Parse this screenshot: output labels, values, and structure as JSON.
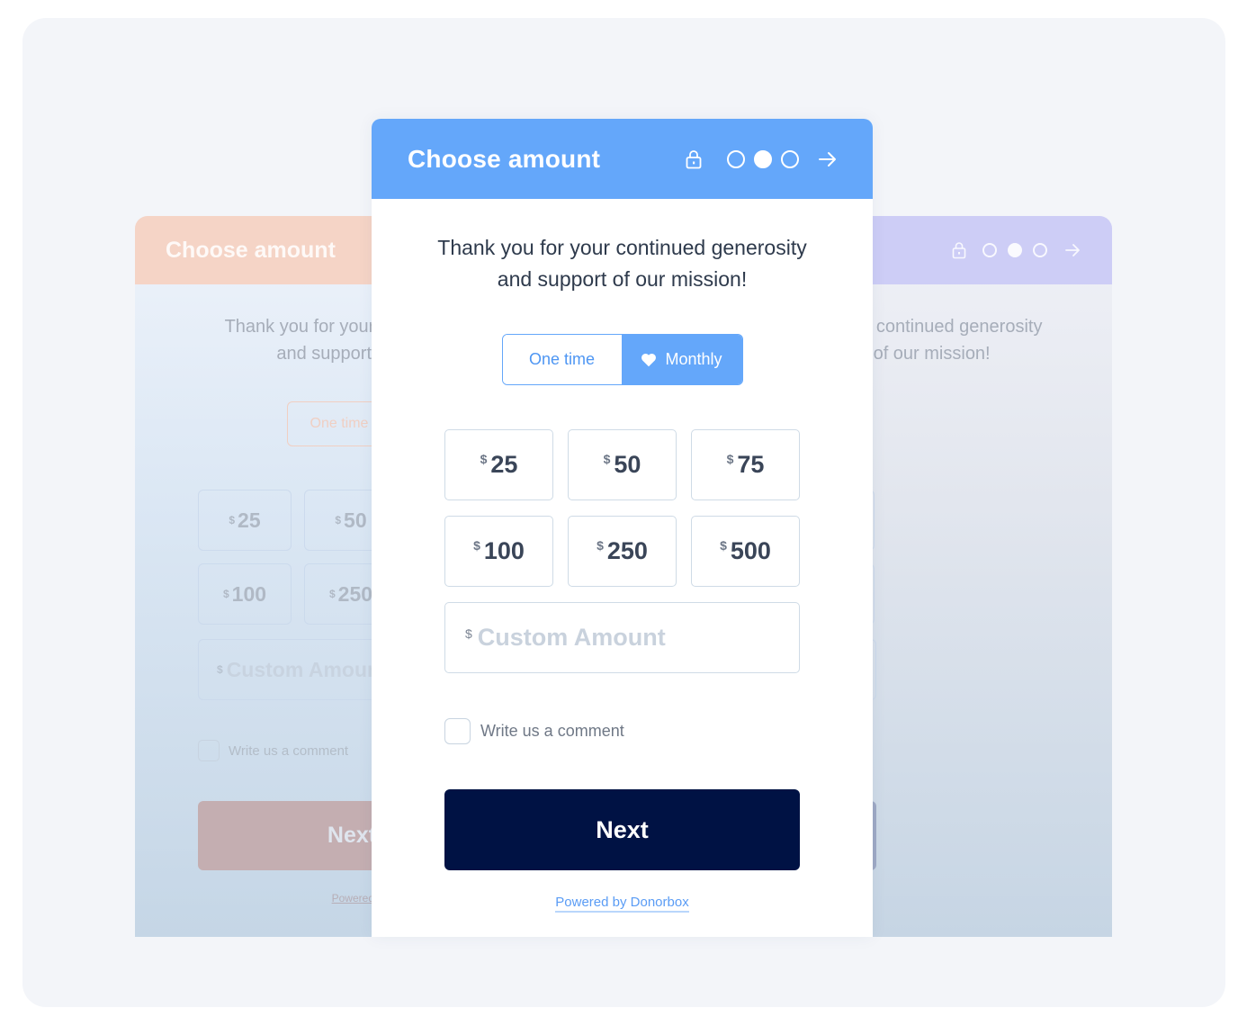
{
  "form": {
    "title": "Choose amount",
    "steps": {
      "total": 3,
      "current": 2
    },
    "message_line1": "Thank you for your continued generosity",
    "message_line2": "and support of our mission!",
    "frequency": {
      "options": [
        "One time",
        "Monthly"
      ],
      "selected": "Monthly"
    },
    "currency_symbol": "$",
    "amounts": [
      "25",
      "50",
      "75",
      "100",
      "250",
      "500"
    ],
    "custom_amount": {
      "value": "",
      "placeholder": "Custom Amount"
    },
    "comment": {
      "label": "Write us a comment",
      "checked": false
    },
    "next_label": "Next",
    "powered_by": "Powered by Donorbox"
  },
  "background_variants": [
    {
      "name": "peach",
      "accent": "#f5d4c6"
    },
    {
      "name": "lavender",
      "accent": "#cdcdf6"
    }
  ],
  "colors": {
    "header": "#64a7fa",
    "next_button": "#001244",
    "link": "#5a9cf5"
  }
}
